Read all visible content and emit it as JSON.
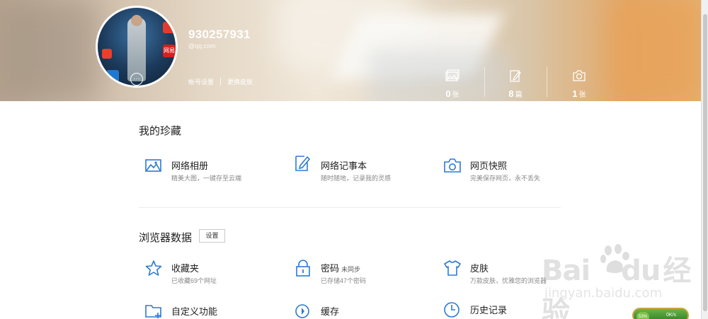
{
  "header": {
    "username": "930257931",
    "email": "@qq.com",
    "account_settings": "帐号设置",
    "change_skin": "更换皮肤",
    "avatar_app_label": "网易",
    "stats": [
      {
        "value": "0",
        "unit": "张",
        "icon": "gallery-icon"
      },
      {
        "value": "8",
        "unit": "篇",
        "icon": "note-icon"
      },
      {
        "value": "1",
        "unit": "张",
        "icon": "camera-icon"
      }
    ]
  },
  "favorites": {
    "title": "我的珍藏",
    "items": [
      {
        "label": "网络相册",
        "desc": "精美大图，一键存至云端",
        "icon": "photo-album-icon"
      },
      {
        "label": "网络记事本",
        "desc": "随时随地，记录我的灵感",
        "icon": "notepad-icon"
      },
      {
        "label": "网页快照",
        "desc": "完美保存网页，永不丢失",
        "icon": "camera-icon"
      }
    ]
  },
  "browser_data": {
    "title": "浏览器数据",
    "settings_button": "设置",
    "items": [
      {
        "label": "收藏夹",
        "sub": "",
        "desc": "已收藏69个网址",
        "icon": "star-icon"
      },
      {
        "label": "密码",
        "sub": "未同步",
        "desc": "已存储47个密码",
        "icon": "lock-icon"
      },
      {
        "label": "皮肤",
        "sub": "",
        "desc": "万款皮肤，优雅您的浏览器",
        "icon": "tshirt-icon"
      },
      {
        "label": "自定义功能",
        "sub": "",
        "desc": "",
        "icon": "folder-add-icon"
      },
      {
        "label": "缓存",
        "sub": "",
        "desc": "",
        "icon": "cache-icon"
      },
      {
        "label": "历史记录",
        "sub": "",
        "desc": "",
        "icon": "clock-icon"
      }
    ]
  },
  "watermark": {
    "brand_left": "Bai",
    "brand_right": "经验",
    "url": "jingyan.baidu.com"
  },
  "speed_widget": {
    "percent": "53%",
    "rate": "0K/s"
  },
  "colors": {
    "accent": "#1a6fc4",
    "icon_blue": "#2b7bd3"
  }
}
